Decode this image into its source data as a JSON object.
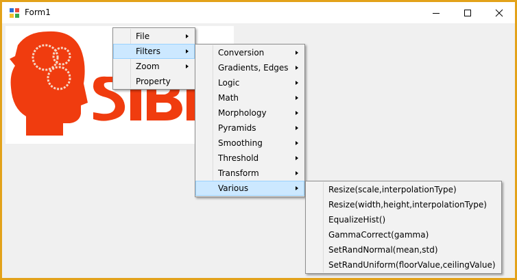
{
  "window": {
    "title": "Form1",
    "icon": "winforms-app-icon"
  },
  "controls": {
    "minimize": "minimize-icon",
    "maximize": "maximize-icon",
    "close": "close-icon"
  },
  "picture": {
    "description_icon": "head-gears-logo-icon",
    "visible_text": "SIBN"
  },
  "menu_main": [
    {
      "label": "File"
    },
    {
      "label": "Filters"
    },
    {
      "label": "Zoom"
    },
    {
      "label": "Property"
    }
  ],
  "menu_filters": [
    {
      "label": "Conversion"
    },
    {
      "label": "Gradients, Edges"
    },
    {
      "label": "Logic"
    },
    {
      "label": "Math"
    },
    {
      "label": "Morphology"
    },
    {
      "label": "Pyramids"
    },
    {
      "label": "Smoothing"
    },
    {
      "label": "Threshold"
    },
    {
      "label": "Transform"
    },
    {
      "label": "Various"
    }
  ],
  "menu_various": [
    {
      "label": "Resize(scale,interpolationType)"
    },
    {
      "label": "Resize(width,height,interpolationType)"
    },
    {
      "label": "EqualizeHist()"
    },
    {
      "label": "GammaCorrect(gamma)"
    },
    {
      "label": "SetRandNormal(mean,std)"
    },
    {
      "label": "SetRandUniform(floorValue,ceilingValue)"
    }
  ],
  "colors": {
    "window_border": "#e3a21a",
    "menu_highlight": "#cce8ff",
    "logo": "#f03c0f"
  }
}
